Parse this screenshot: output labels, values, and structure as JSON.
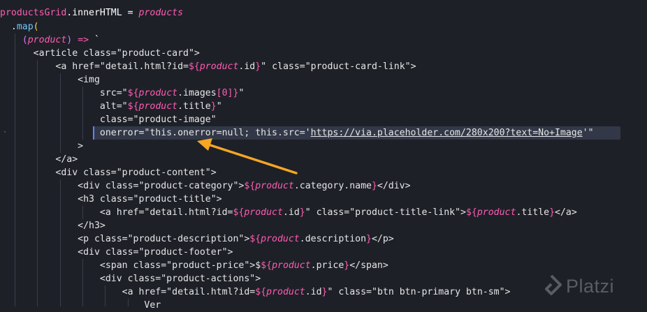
{
  "code_lines": [
    "productsGrid.innerHTML = products",
    "  .map(",
    "    (product) => `",
    "      <article class=\"product-card\">",
    "          <a href=\"detail.html?id=${product.id}\" class=\"product-card-link\">",
    "              <img",
    "                  src=\"${product.images[0]}\"",
    "                  alt=\"${product.title}\"",
    "                  class=\"product-image\"",
    "                  onerror=\"this.onerror=null; this.src='https://via.placeholder.com/280x200?text=No+Image'\"",
    "              >",
    "          </a>",
    "          <div class=\"product-content\">",
    "              <div class=\"product-category\">${product.category.name}</div>",
    "              <h3 class=\"product-title\">",
    "                  <a href=\"detail.html?id=${product.id}\" class=\"product-title-link\">${product.title}</a>",
    "              </h3>",
    "              <p class=\"product-description\">${product.description}</p>",
    "              <div class=\"product-footer\">",
    "                  <span class=\"product-price\">$${product.price}</span>",
    "                  <div class=\"product-actions\">",
    "                      <a href=\"detail.html?id=${product.id}\" class=\"btn btn-primary btn-sm\">",
    "                          Ver"
  ],
  "watermark": {
    "text": "Platzi"
  },
  "annotation": {
    "shape": "arrow",
    "color": "#f5a623"
  }
}
